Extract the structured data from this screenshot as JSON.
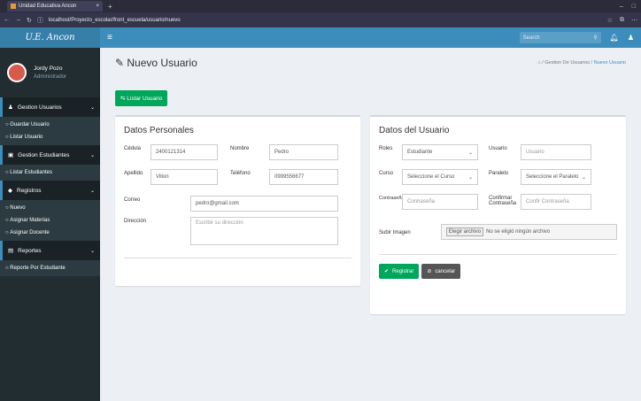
{
  "browser": {
    "tab_title": "Unidad Educativa Ancon",
    "url": "localhost/Proyecto_escolar/front_escuela/usuario/nuevo"
  },
  "brand": "U.E. Ancon",
  "user": {
    "name": "Jordy Pozo",
    "role": "Administrador"
  },
  "sidebar": [
    {
      "header": "Gestion Usuarios",
      "items": [
        "Guardar Usuario",
        "Listar Usuario"
      ]
    },
    {
      "header": "Gestion Estudiantes",
      "items": [
        "Listar Estudiantes"
      ]
    },
    {
      "header": "Registros",
      "items": [
        "Nuevo",
        "Asignar Materias",
        "Asignar Docente"
      ]
    },
    {
      "header": "Reportes",
      "items": [
        "Reporte Por Estudiante"
      ]
    }
  ],
  "search": {
    "placeholder": "Search"
  },
  "page": {
    "title": "Nuevo Usuario",
    "crumb_home": "/ Gestion De Usuarios /",
    "crumb_current": "Nuevo Usuario",
    "list_button": "Listar Usuario"
  },
  "personal": {
    "title": "Datos Personales",
    "cedula_label": "Cédula",
    "cedula": "2400121314",
    "nombre_label": "Nombre",
    "nombre": "Pedro",
    "apellido_label": "Apellido",
    "apellido": "Villon",
    "telefono_label": "Teléfono",
    "telefono": "0999556677",
    "correo_label": "Correo",
    "correo": "pedro@gmail.com",
    "direccion_label": "Dirección",
    "direccion_ph": "Escribir su dirección"
  },
  "account": {
    "title": "Datos del Usuario",
    "roles_label": "Roles",
    "roles_value": "Estudiante",
    "usuario_label": "Usuario",
    "usuario_ph": "Usuario",
    "curso_label": "Curso",
    "curso_value": "Seleccione el Curso",
    "paralelo_label": "Paralelo",
    "paralelo_value": "Seleccione el Paralelo",
    "contrasena_label": "Contraseña",
    "contrasena_ph": "Contraseña",
    "confirmar_label": "Confirmar Contraseña",
    "confirmar_ph": "Confir Contraseña",
    "imagen_label": "Subir Imagen",
    "file_button": "Elegir archivo",
    "file_text": "No se eligió ningún archivo",
    "register_button": "Registrar",
    "cancel_button": "cancelar"
  },
  "colors": {
    "topbar": "#3c8dbc",
    "sidebar": "#222d32",
    "accent_green": "#00a65a"
  }
}
